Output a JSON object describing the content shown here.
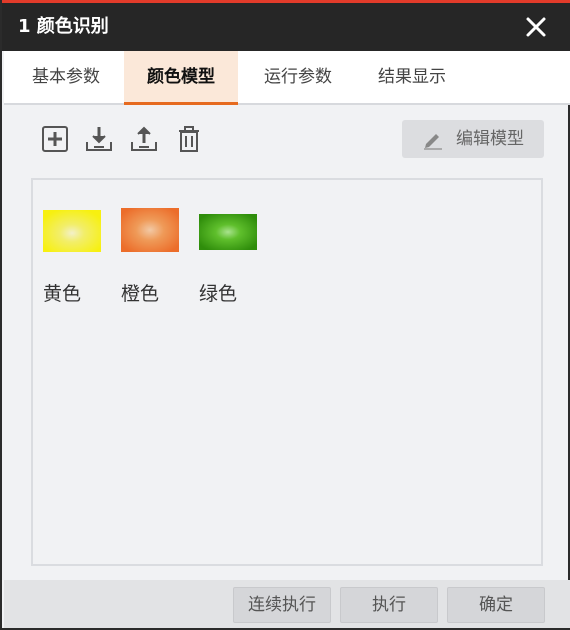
{
  "window": {
    "title": "1 颜色识别"
  },
  "tabs": [
    {
      "label": "基本参数",
      "active": false
    },
    {
      "label": "颜色模型",
      "active": true
    },
    {
      "label": "运行参数",
      "active": false
    },
    {
      "label": "结果显示",
      "active": false
    }
  ],
  "toolbar": {
    "icons": [
      "add-icon",
      "import-icon",
      "export-icon",
      "delete-icon"
    ],
    "edit_model_label": "编辑模型"
  },
  "models": [
    {
      "label": "黄色",
      "color": "#f6f31a"
    },
    {
      "label": "橙色",
      "color": "#f07a2c"
    },
    {
      "label": "绿色",
      "color": "#3fa10f"
    }
  ],
  "footer": {
    "continuous_run_label": "连续执行",
    "run_label": "执行",
    "confirm_label": "确定"
  },
  "colors": {
    "titlebar": "#262626",
    "accent": "#e23b2a",
    "tab_active_bg": "#fbe8d9",
    "tab_active_underline": "#e66a1f"
  }
}
